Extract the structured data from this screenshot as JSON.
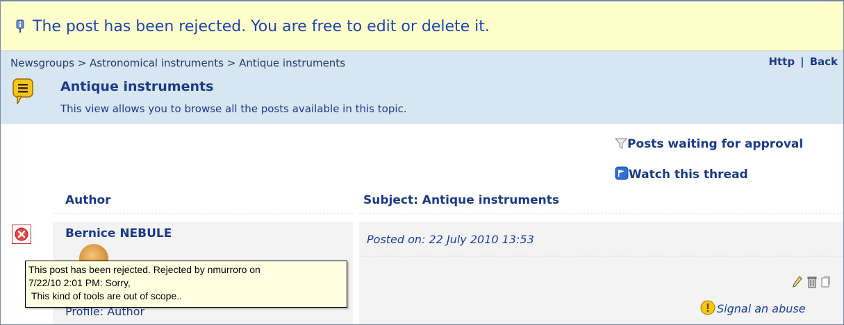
{
  "notice": {
    "icon": "info-pin-icon",
    "message": "The post has been rejected. You are free to edit or delete it."
  },
  "breadcrumb": {
    "items": [
      "Newsgroups",
      "Astronomical instruments",
      "Antique instruments"
    ],
    "separator": ">"
  },
  "toplinks": {
    "http": "Http",
    "back": "Back"
  },
  "topic": {
    "icon": "speech-bubble-icon",
    "title": "Antique instruments",
    "description": "This view allows you to browse all the posts available in this topic."
  },
  "actions": {
    "waiting": "Posts waiting for approval",
    "watch": "Watch this thread"
  },
  "table": {
    "author_header": "Author",
    "subject_header": "Subject: Antique instruments"
  },
  "post": {
    "status_icon": "rejected-icon",
    "author": "Bernice NEBULE",
    "profile": "Profile: Author",
    "posted_on": "Posted on: 22 July 2010 13:53",
    "signal": "Signal an abuse"
  },
  "tooltip": {
    "text": "This post has been rejected. Rejected by nmurroro on\n7/22/10 2:01 PM: Sorry,\n This kind of tools are out of scope.."
  },
  "colors": {
    "notice_bg": "#ffffcc",
    "header_bg": "#d8e6f2",
    "link": "#1a3a8a",
    "reject": "#d83030",
    "tooltip_bg": "#ffffe1"
  }
}
